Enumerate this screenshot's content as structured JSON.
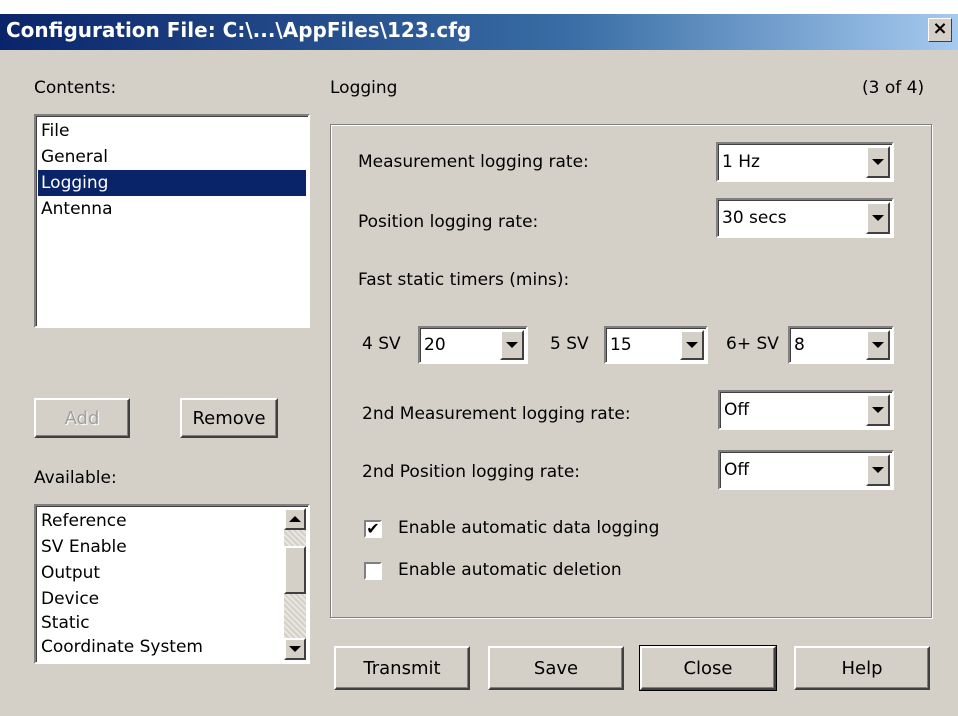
{
  "window": {
    "title": "Configuration File: C:\\...\\AppFiles\\123.cfg",
    "close_glyph": "×",
    "titlebar_color": "#0a246a"
  },
  "contents": {
    "label": "Contents:",
    "items": [
      "File",
      "General",
      "Logging",
      "Antenna"
    ],
    "selected": "Logging"
  },
  "buttons": {
    "add": "Add",
    "remove": "Remove",
    "transmit": "Transmit",
    "save": "Save",
    "close": "Close",
    "help": "Help"
  },
  "available": {
    "label": "Available:",
    "items": [
      "Reference",
      "SV Enable",
      "Output",
      "Device",
      "Static",
      "Coordinate System"
    ]
  },
  "section": {
    "title": "Logging",
    "page_indicator": "(3 of 4)"
  },
  "logging": {
    "measurement_rate_label": "Measurement logging rate:",
    "measurement_rate_value": "1 Hz",
    "position_rate_label": "Position logging rate:",
    "position_rate_value": "30 secs",
    "fast_static_label": "Fast static timers (mins):",
    "sv4_label": "4 SV",
    "sv4_value": "20",
    "sv5_label": "5 SV",
    "sv5_value": "15",
    "sv6_label": "6+ SV",
    "sv6_value": "8",
    "second_measurement_label": "2nd Measurement logging rate:",
    "second_measurement_value": "Off",
    "second_position_label": "2nd Position logging rate:",
    "second_position_value": "Off",
    "auto_logging_label": "Enable automatic data logging",
    "auto_logging_checked": true,
    "auto_logging_mark": "✔",
    "auto_deletion_label": "Enable automatic deletion",
    "auto_deletion_checked": false
  }
}
